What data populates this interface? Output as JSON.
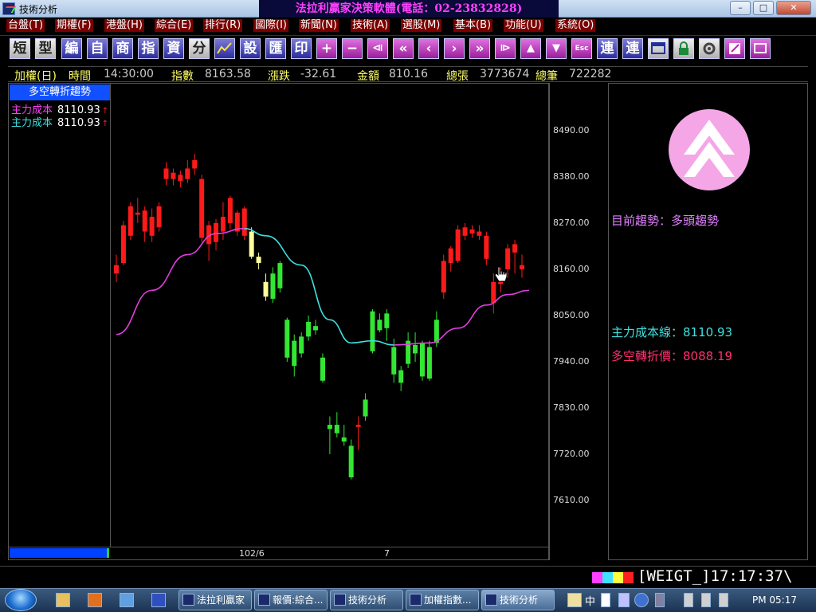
{
  "window": {
    "title": "技術分析",
    "banner": "法拉利贏家決策軟體(電話：02-23832828)",
    "controls": {
      "minimize": "–",
      "maximize": "□",
      "close": "✕"
    }
  },
  "menu": [
    {
      "label": "台盤(T)"
    },
    {
      "label": "期權(F)"
    },
    {
      "label": "港盤(H)"
    },
    {
      "label": "綜合(E)"
    },
    {
      "label": "排行(R)"
    },
    {
      "label": "國際(I)"
    },
    {
      "label": "新聞(N)"
    },
    {
      "label": "技術(A)"
    },
    {
      "label": "選股(M)"
    },
    {
      "label": "基本(B)"
    },
    {
      "label": "功能(U)"
    },
    {
      "label": "系統(O)"
    }
  ],
  "toolbar": [
    {
      "label": "短",
      "icon": "short-term-icon"
    },
    {
      "label": "型",
      "icon": "pattern-icon"
    },
    {
      "label": "編",
      "icon": "edit-icon"
    },
    {
      "label": "自",
      "icon": "custom-icon"
    },
    {
      "label": "商",
      "icon": "commodity-icon"
    },
    {
      "label": "指",
      "icon": "index-icon"
    },
    {
      "label": "資",
      "icon": "data-icon"
    },
    {
      "label": "分",
      "icon": "minute-icon"
    },
    {
      "label": "",
      "icon": "chart-icon"
    },
    {
      "label": "設",
      "icon": "settings-icon"
    },
    {
      "label": "匯",
      "icon": "export-icon"
    },
    {
      "label": "印",
      "icon": "print-icon"
    },
    {
      "label": "+",
      "icon": "zoom-in-icon"
    },
    {
      "label": "−",
      "icon": "zoom-out-icon"
    },
    {
      "label": "⧏",
      "icon": "first-icon"
    },
    {
      "label": "«",
      "icon": "fast-back-icon"
    },
    {
      "label": "‹",
      "icon": "back-icon"
    },
    {
      "label": "›",
      "icon": "forward-icon"
    },
    {
      "label": "»",
      "icon": "fast-forward-icon"
    },
    {
      "label": "⧐",
      "icon": "last-icon"
    },
    {
      "label": "▲",
      "icon": "up-icon"
    },
    {
      "label": "▼",
      "icon": "down-icon"
    },
    {
      "label": "Esc",
      "icon": "escape-icon"
    },
    {
      "label": "連",
      "icon": "link-icon"
    },
    {
      "label": "連",
      "icon": "link2-icon"
    },
    {
      "label": "",
      "icon": "window-icon"
    },
    {
      "label": "",
      "icon": "lock-icon"
    },
    {
      "label": "",
      "icon": "tools-icon"
    },
    {
      "label": "",
      "icon": "note-icon"
    },
    {
      "label": "",
      "icon": "screen-icon"
    }
  ],
  "infobar": {
    "name": "加權(日)",
    "time_label": "時間",
    "time": "14:30:00",
    "index_label": "指數",
    "index": "8163.58",
    "change_label": "漲跌",
    "change": "-32.61",
    "amount_label": "金額",
    "amount": "810.16",
    "volume_label": "總張",
    "volume": "3773674",
    "trades_label": "總筆",
    "trades": "722282"
  },
  "legend": {
    "title": "多空轉折趨勢",
    "lines": [
      {
        "name": "主力成本",
        "value": "8110.93",
        "arrow": "↑",
        "color": "#ff40ff"
      },
      {
        "name": "主力成本",
        "value": "8110.93",
        "arrow": "↑",
        "color": "#40e0e0"
      }
    ]
  },
  "right_panel": {
    "trend_label": "目前趨勢：多頭趨勢",
    "cost_label": "主力成本線：",
    "cost_value": "8110.93",
    "turn_label": "多空轉折價：",
    "turn_value": "8088.19"
  },
  "status": {
    "code": "[WEIGT_]17:17:37\\",
    "colors": [
      "#ff40ff",
      "#40e0ff",
      "#ffff40",
      "#ff2020"
    ]
  },
  "taskbar": {
    "buttons": [
      {
        "label": "法拉利贏家",
        "active": false
      },
      {
        "label": "報價:綜合...",
        "active": false
      },
      {
        "label": "技術分析",
        "active": false
      },
      {
        "label": "加權指數...",
        "active": false
      },
      {
        "label": "技術分析",
        "active": true
      }
    ],
    "tray": "中",
    "clock": "PM 05:17"
  },
  "chart_data": {
    "type": "candlestick",
    "title": "",
    "y_ticks": [
      "8490.00",
      "8380.00",
      "8270.00",
      "8160.00",
      "8050.00",
      "7940.00",
      "7830.00",
      "7720.00",
      "7610.00"
    ],
    "y_range": [
      7560,
      8610
    ],
    "x_labels": [
      {
        "label": "102/6",
        "index": 19
      },
      {
        "label": "7",
        "index": 41
      }
    ],
    "up_color": "#ff1a1a",
    "down_color": "#33e633",
    "neutral_color": "#ffff99",
    "candles": [
      {
        "o": 8170,
        "h": 8195,
        "l": 8130,
        "c": 8150,
        "t": "up"
      },
      {
        "o": 8175,
        "h": 8275,
        "l": 8170,
        "c": 8265,
        "t": "up"
      },
      {
        "o": 8240,
        "h": 8320,
        "l": 8230,
        "c": 8310,
        "t": "up"
      },
      {
        "o": 8290,
        "h": 8330,
        "l": 8270,
        "c": 8295,
        "t": "up"
      },
      {
        "o": 8250,
        "h": 8310,
        "l": 8225,
        "c": 8300,
        "t": "up"
      },
      {
        "o": 8240,
        "h": 8305,
        "l": 8225,
        "c": 8285,
        "t": "up"
      },
      {
        "o": 8260,
        "h": 8320,
        "l": 8250,
        "c": 8310,
        "t": "up"
      },
      {
        "o": 8375,
        "h": 8415,
        "l": 8360,
        "c": 8400,
        "t": "up"
      },
      {
        "o": 8375,
        "h": 8400,
        "l": 8360,
        "c": 8390,
        "t": "up"
      },
      {
        "o": 8370,
        "h": 8395,
        "l": 8355,
        "c": 8385,
        "t": "up"
      },
      {
        "o": 8375,
        "h": 8420,
        "l": 8365,
        "c": 8400,
        "t": "up"
      },
      {
        "o": 8400,
        "h": 8435,
        "l": 8385,
        "c": 8420,
        "t": "up"
      },
      {
        "o": 8235,
        "h": 8385,
        "l": 8225,
        "c": 8375,
        "t": "up"
      },
      {
        "o": 8220,
        "h": 8275,
        "l": 8180,
        "c": 8265,
        "t": "up"
      },
      {
        "o": 8225,
        "h": 8280,
        "l": 8205,
        "c": 8270,
        "t": "up"
      },
      {
        "o": 8250,
        "h": 8320,
        "l": 8230,
        "c": 8285,
        "t": "up"
      },
      {
        "o": 8270,
        "h": 8335,
        "l": 8255,
        "c": 8330,
        "t": "up"
      },
      {
        "o": 8250,
        "h": 8300,
        "l": 8240,
        "c": 8295,
        "t": "up"
      },
      {
        "o": 8240,
        "h": 8310,
        "l": 8230,
        "c": 8305,
        "t": "up"
      },
      {
        "o": 8250,
        "h": 8260,
        "l": 8185,
        "c": 8190,
        "t": "neutral"
      },
      {
        "o": 8190,
        "h": 8200,
        "l": 8160,
        "c": 8175,
        "t": "neutral"
      },
      {
        "o": 8130,
        "h": 8150,
        "l": 8085,
        "c": 8095,
        "t": "neutral"
      },
      {
        "o": 8150,
        "h": 8165,
        "l": 8080,
        "c": 8090,
        "t": "down"
      },
      {
        "o": 8175,
        "h": 8180,
        "l": 8105,
        "c": 8115,
        "t": "down"
      },
      {
        "o": 8040,
        "h": 8045,
        "l": 7940,
        "c": 7950,
        "t": "down"
      },
      {
        "o": 7990,
        "h": 8005,
        "l": 7905,
        "c": 7930,
        "t": "down"
      },
      {
        "o": 8000,
        "h": 8010,
        "l": 7950,
        "c": 7960,
        "t": "down"
      },
      {
        "o": 8035,
        "h": 8050,
        "l": 7990,
        "c": 8000,
        "t": "down"
      },
      {
        "o": 8025,
        "h": 8040,
        "l": 8005,
        "c": 8015,
        "t": "down"
      },
      {
        "o": 7950,
        "h": 7960,
        "l": 7890,
        "c": 7895,
        "t": "down"
      },
      {
        "o": 7790,
        "h": 7810,
        "l": 7720,
        "c": 7780,
        "t": "down"
      },
      {
        "o": 7790,
        "h": 7820,
        "l": 7760,
        "c": 7770,
        "t": "down"
      },
      {
        "o": 7760,
        "h": 7790,
        "l": 7740,
        "c": 7750,
        "t": "down"
      },
      {
        "o": 7740,
        "h": 7755,
        "l": 7660,
        "c": 7665,
        "t": "down"
      },
      {
        "o": 7785,
        "h": 7810,
        "l": 7730,
        "c": 7790,
        "t": "up"
      },
      {
        "o": 7850,
        "h": 7865,
        "l": 7800,
        "c": 7810,
        "t": "down"
      },
      {
        "o": 8060,
        "h": 8065,
        "l": 7960,
        "c": 7965,
        "t": "down"
      },
      {
        "o": 8040,
        "h": 8055,
        "l": 8010,
        "c": 8015,
        "t": "down"
      },
      {
        "o": 8055,
        "h": 8065,
        "l": 7990,
        "c": 8020,
        "t": "down"
      },
      {
        "o": 7975,
        "h": 7995,
        "l": 7890,
        "c": 7910,
        "t": "down"
      },
      {
        "o": 7920,
        "h": 7930,
        "l": 7870,
        "c": 7890,
        "t": "down"
      },
      {
        "o": 7990,
        "h": 8010,
        "l": 7925,
        "c": 7935,
        "t": "down"
      },
      {
        "o": 7960,
        "h": 8010,
        "l": 7940,
        "c": 7980,
        "t": "down"
      },
      {
        "o": 7985,
        "h": 7990,
        "l": 7895,
        "c": 7905,
        "t": "down"
      },
      {
        "o": 7975,
        "h": 7990,
        "l": 7895,
        "c": 7900,
        "t": "down"
      },
      {
        "o": 8040,
        "h": 8060,
        "l": 7975,
        "c": 7985,
        "t": "down"
      },
      {
        "o": 8105,
        "h": 8195,
        "l": 8090,
        "c": 8180,
        "t": "up"
      },
      {
        "o": 8175,
        "h": 8215,
        "l": 8155,
        "c": 8210,
        "t": "up"
      },
      {
        "o": 8180,
        "h": 8265,
        "l": 8175,
        "c": 8255,
        "t": "up"
      },
      {
        "o": 8240,
        "h": 8270,
        "l": 8230,
        "c": 8260,
        "t": "up"
      },
      {
        "o": 8245,
        "h": 8265,
        "l": 8235,
        "c": 8255,
        "t": "up"
      },
      {
        "o": 8240,
        "h": 8265,
        "l": 8230,
        "c": 8250,
        "t": "up"
      },
      {
        "o": 8185,
        "h": 8250,
        "l": 8170,
        "c": 8240,
        "t": "up"
      },
      {
        "o": 8080,
        "h": 8150,
        "l": 8055,
        "c": 8130,
        "t": "up"
      },
      {
        "o": 8130,
        "h": 8165,
        "l": 8105,
        "c": 8125,
        "t": "up"
      },
      {
        "o": 8160,
        "h": 8220,
        "l": 8140,
        "c": 8210,
        "t": "up"
      },
      {
        "o": 8200,
        "h": 8230,
        "l": 8150,
        "c": 8220,
        "t": "up"
      },
      {
        "o": 8160,
        "h": 8195,
        "l": 8140,
        "c": 8170,
        "t": "up"
      }
    ],
    "ma_line": [
      {
        "i": 0,
        "v": 8005,
        "c": "#e040e0"
      },
      {
        "i": 5,
        "v": 8110,
        "c": "#e040e0"
      },
      {
        "i": 10,
        "v": 8195,
        "c": "#e040e0"
      },
      {
        "i": 14,
        "v": 8245,
        "c": "#e040e0"
      },
      {
        "i": 18,
        "v": 8257,
        "c": "#e040e0"
      },
      {
        "i": 21,
        "v": 8240,
        "c": "#40e0e0"
      },
      {
        "i": 26,
        "v": 8170,
        "c": "#40e0e0"
      },
      {
        "i": 30,
        "v": 8040,
        "c": "#40e0e0"
      },
      {
        "i": 33,
        "v": 7985,
        "c": "#40e0e0"
      },
      {
        "i": 36,
        "v": 7990,
        "c": "#40e0e0"
      },
      {
        "i": 39,
        "v": 7980,
        "c": "#40e0e0"
      },
      {
        "i": 44,
        "v": 7985,
        "c": "#e040e0"
      },
      {
        "i": 48,
        "v": 8020,
        "c": "#e040e0"
      },
      {
        "i": 52,
        "v": 8075,
        "c": "#e040e0"
      },
      {
        "i": 55,
        "v": 8100,
        "c": "#e040e0"
      },
      {
        "i": 58,
        "v": 8110,
        "c": "#e040e0"
      }
    ]
  }
}
